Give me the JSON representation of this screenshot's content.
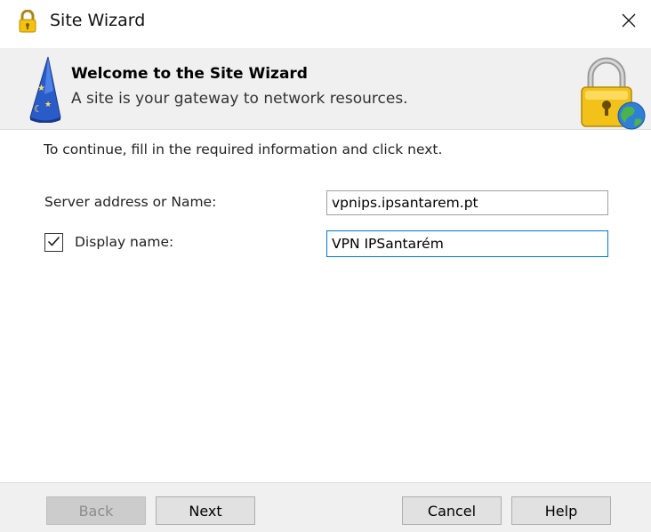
{
  "window": {
    "title": "Site Wizard",
    "close_icon": "close-icon",
    "title_icon": "padlock-icon"
  },
  "banner": {
    "title": "Welcome to the Site Wizard",
    "subtitle": "A site is your gateway to network resources.",
    "left_icon": "wizard-hat-icon",
    "right_icon": "padlock-globe-icon"
  },
  "form": {
    "instructions": "To continue, fill in the required information and click next.",
    "server": {
      "label": "Server address or Name:",
      "value": "vpnips.ipsantarem.pt"
    },
    "display": {
      "label": "Display name:",
      "checked": true,
      "value": "VPN IPSantarém"
    }
  },
  "buttons": {
    "back": "Back",
    "next": "Next",
    "cancel": "Cancel",
    "help": "Help"
  },
  "colors": {
    "banner_bg": "#f0f0f0",
    "focus_border": "#0078d7",
    "footer_bg": "#f0f0f0"
  }
}
